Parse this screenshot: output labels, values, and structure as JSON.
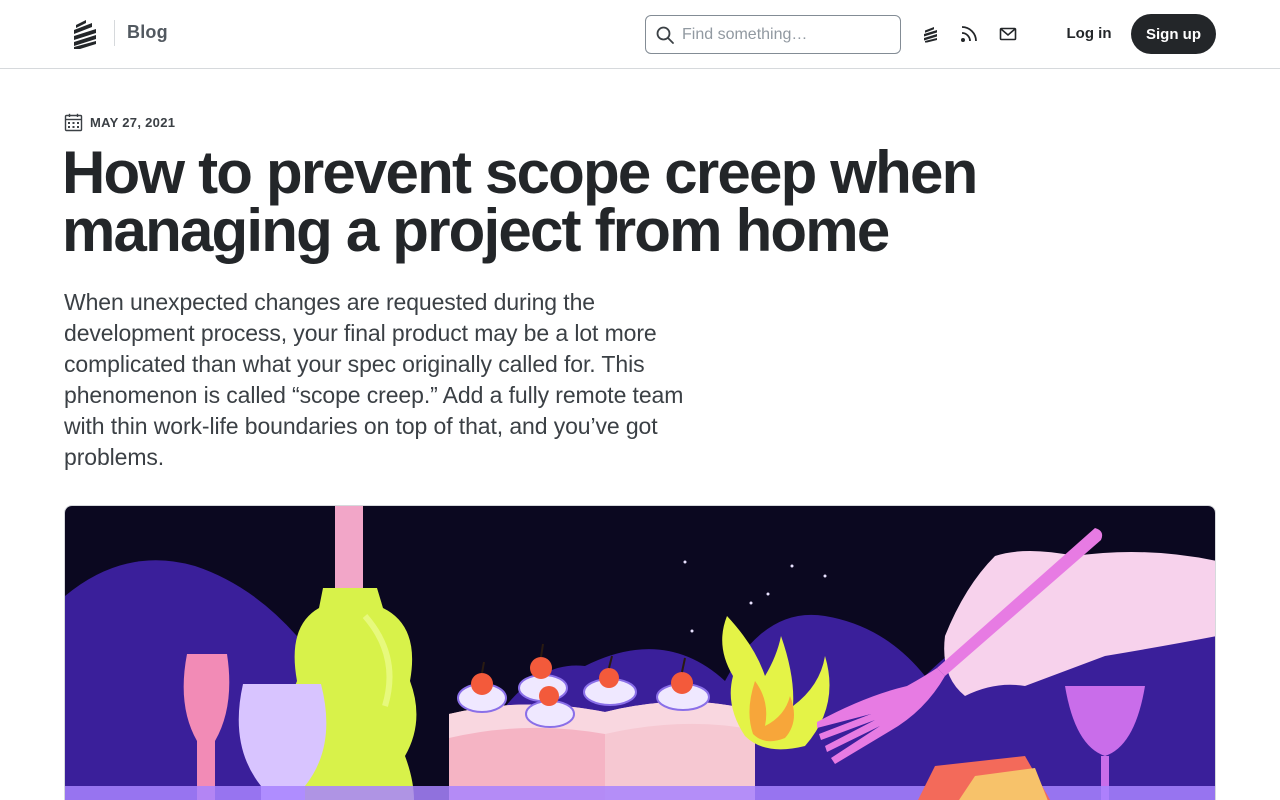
{
  "header": {
    "section_label": "Blog",
    "search": {
      "placeholder": "Find something…",
      "value": ""
    },
    "icons": [
      "stack-logo-icon",
      "rss-icon",
      "mail-icon"
    ],
    "login_label": "Log in",
    "signup_label": "Sign up"
  },
  "article": {
    "date": "MAY 27, 2021",
    "title": "How to prevent scope creep when managing a project from home",
    "lede": "When unexpected changes are requested during the development process, your final product may be a lot more complicated than what your spec originally called for. This phenomenon is called “scope creep.” Add a fully remote team with thin work-life boundaries on top of that, and you’ve got problems."
  },
  "colors": {
    "text": "#232629",
    "button_dark": "#232629",
    "border": "#d6d9dc",
    "hero_sky": "#0b0820",
    "hero_hills": "#3a1f9a"
  }
}
